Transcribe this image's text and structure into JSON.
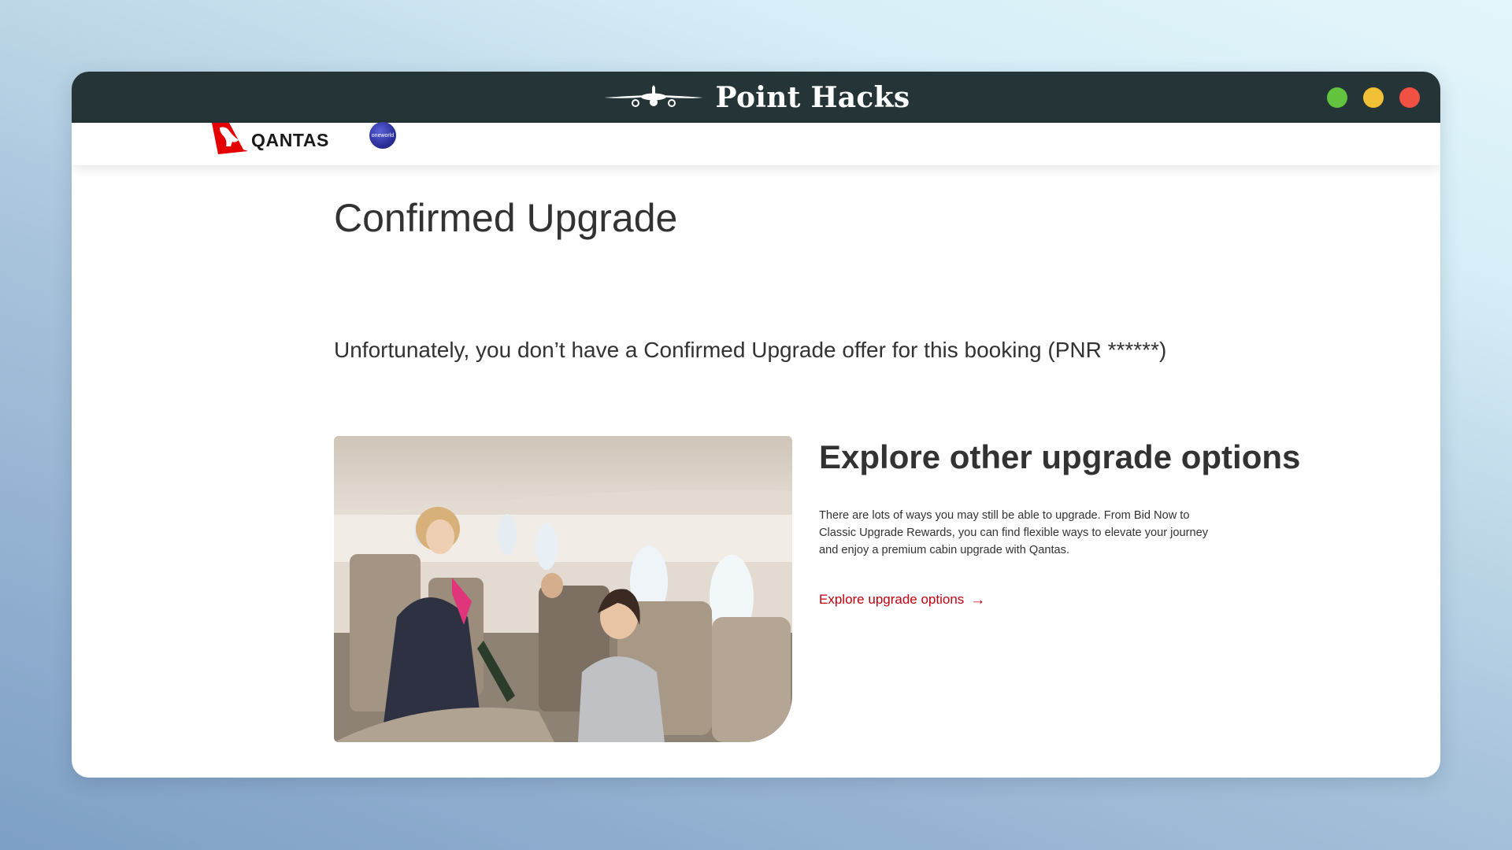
{
  "titlebar": {
    "brand_name": "Point Hacks",
    "brand_icon": "airplane-icon",
    "window_controls": [
      {
        "name": "green-window-control",
        "color": "#62c33e"
      },
      {
        "name": "yellow-window-control",
        "color": "#f1c036"
      },
      {
        "name": "red-window-control",
        "color": "#f05143"
      }
    ]
  },
  "header": {
    "logo_text": "QANTAS",
    "logo_icon": "kangaroo-icon",
    "alliance_badge": "oneworld",
    "brand_color": "#e40000"
  },
  "main": {
    "title": "Confirmed Upgrade",
    "notice": "Unfortunately, you don’t have a Confirmed Upgrade offer for this booking (PNR ******)",
    "promo": {
      "heading": "Explore other upgrade options",
      "body": "There are lots of ways you may still be able to upgrade. From Bid Now to Classic Upgrade Rewards, you can find flexible ways to elevate your journey and enjoy a premium cabin upgrade with Qantas.",
      "link_label": "Explore upgrade options",
      "link_arrow": "→",
      "link_color": "#c3000f"
    }
  }
}
